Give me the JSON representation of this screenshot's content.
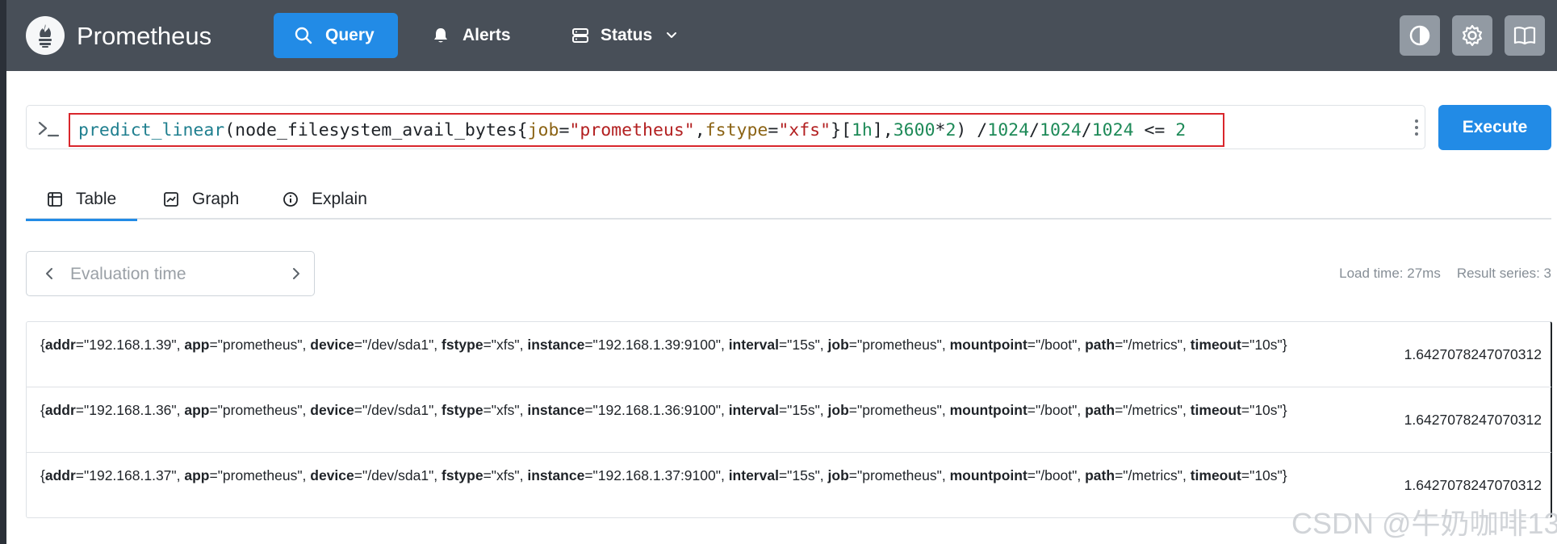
{
  "navbar": {
    "brand": "Prometheus",
    "items": [
      {
        "label": "Query",
        "icon": "search-icon",
        "active": true
      },
      {
        "label": "Alerts",
        "icon": "bell-icon"
      },
      {
        "label": "Status",
        "icon": "server-icon"
      }
    ],
    "icon_buttons": [
      "theme-toggle-icon",
      "gear-icon",
      "book-icon"
    ]
  },
  "query": {
    "tokens": [
      {
        "t": "predict_linear",
        "c": "fn"
      },
      {
        "t": "(node_filesystem_avail_bytes{",
        "c": "plain"
      },
      {
        "t": "job",
        "c": "lbl"
      },
      {
        "t": "=",
        "c": "plain"
      },
      {
        "t": "\"prometheus\"",
        "c": "str"
      },
      {
        "t": ",",
        "c": "plain"
      },
      {
        "t": "fstype",
        "c": "lbl"
      },
      {
        "t": "=",
        "c": "plain"
      },
      {
        "t": "\"xfs\"",
        "c": "str"
      },
      {
        "t": "}[",
        "c": "plain"
      },
      {
        "t": "1h",
        "c": "num"
      },
      {
        "t": "],",
        "c": "plain"
      },
      {
        "t": "3600",
        "c": "num"
      },
      {
        "t": "*",
        "c": "plain"
      },
      {
        "t": "2",
        "c": "num"
      },
      {
        "t": ") /",
        "c": "plain"
      },
      {
        "t": "1024",
        "c": "num"
      },
      {
        "t": "/",
        "c": "plain"
      },
      {
        "t": "1024",
        "c": "num"
      },
      {
        "t": "/",
        "c": "plain"
      },
      {
        "t": "1024",
        "c": "num"
      },
      {
        "t": " <= ",
        "c": "plain"
      },
      {
        "t": "2",
        "c": "num"
      }
    ],
    "execute_label": "Execute"
  },
  "tabs": [
    {
      "label": "Table",
      "active": true
    },
    {
      "label": "Graph"
    },
    {
      "label": "Explain"
    }
  ],
  "eval_time": {
    "placeholder": "Evaluation time"
  },
  "stats": {
    "load_time": "Load time: 27ms",
    "result_series": "Result series: 3"
  },
  "results": [
    {
      "labels": [
        [
          "addr",
          "192.168.1.39"
        ],
        [
          "app",
          "prometheus"
        ],
        [
          "device",
          "/dev/sda1"
        ],
        [
          "fstype",
          "xfs"
        ],
        [
          "instance",
          "192.168.1.39:9100"
        ],
        [
          "interval",
          "15s"
        ],
        [
          "job",
          "prometheus"
        ],
        [
          "mountpoint",
          "/boot"
        ],
        [
          "path",
          "/metrics"
        ],
        [
          "timeout",
          "10s"
        ]
      ],
      "value": "1.6427078247070312"
    },
    {
      "labels": [
        [
          "addr",
          "192.168.1.36"
        ],
        [
          "app",
          "prometheus"
        ],
        [
          "device",
          "/dev/sda1"
        ],
        [
          "fstype",
          "xfs"
        ],
        [
          "instance",
          "192.168.1.36:9100"
        ],
        [
          "interval",
          "15s"
        ],
        [
          "job",
          "prometheus"
        ],
        [
          "mountpoint",
          "/boot"
        ],
        [
          "path",
          "/metrics"
        ],
        [
          "timeout",
          "10s"
        ]
      ],
      "value": "1.6427078247070312"
    },
    {
      "labels": [
        [
          "addr",
          "192.168.1.37"
        ],
        [
          "app",
          "prometheus"
        ],
        [
          "device",
          "/dev/sda1"
        ],
        [
          "fstype",
          "xfs"
        ],
        [
          "instance",
          "192.168.1.37:9100"
        ],
        [
          "interval",
          "15s"
        ],
        [
          "job",
          "prometheus"
        ],
        [
          "mountpoint",
          "/boot"
        ],
        [
          "path",
          "/metrics"
        ],
        [
          "timeout",
          "10s"
        ]
      ],
      "value": "1.6427078247070312"
    }
  ],
  "watermark": "CSDN @牛奶咖啡13",
  "colors": {
    "accent": "#228be6",
    "navbar": "#484f58",
    "highlight_border": "#d9262c"
  }
}
